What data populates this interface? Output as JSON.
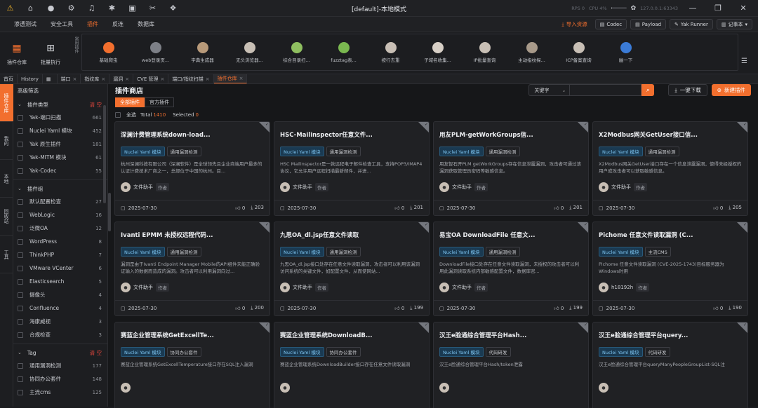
{
  "window": {
    "title": "[default]-本地模式",
    "rps_label": "RPS 0",
    "cpu_label": "CPU 4%",
    "cpu_pct": 0.04,
    "host": "127.0.0.1:63343"
  },
  "menu": {
    "items": [
      "渗透测试",
      "安全工具",
      "插件",
      "反连",
      "数据库"
    ],
    "active": "插件",
    "import": "导入资源",
    "codec": "Codec",
    "payload": "Payload",
    "yakrunner": "Yak Runner",
    "notebook": "记事本"
  },
  "toolbar": {
    "plugin_store": "插件仓库",
    "batch_exec": "批量执行",
    "fav_label": "常用插件",
    "favorites": [
      {
        "label": "基础爬虫",
        "color": "#f26f2e"
      },
      {
        "label": "web登录页...",
        "color": "#7d8087"
      },
      {
        "label": "字典生成器",
        "color": "#b89a7a"
      },
      {
        "label": "无头浏览器...",
        "color": "#c8bfb5"
      },
      {
        "label": "综合目录扫...",
        "color": "#8fbf60"
      },
      {
        "label": "fuzztag表...",
        "color": "#7ab850"
      },
      {
        "label": "按行去重",
        "color": "#c8bfb5"
      },
      {
        "label": "子域名收集...",
        "color": "#d7cfc6"
      },
      {
        "label": "IP批量查询",
        "color": "#c8bfb5"
      },
      {
        "label": "主动指纹探...",
        "color": "#a89a8a"
      },
      {
        "label": "ICP备案查询",
        "color": "#c8bfb5"
      },
      {
        "label": "幽一下",
        "color": "#3b7bd6"
      }
    ]
  },
  "tabs": [
    {
      "label": "首页"
    },
    {
      "label": "History"
    },
    {
      "label": ""
    },
    {
      "label": "端口",
      "close": "×"
    },
    {
      "label": "指纹库",
      "close": "×"
    },
    {
      "label": "漏洞",
      "close": "×"
    },
    {
      "label": "CVE 管理",
      "close": "×"
    },
    {
      "label": "端口/指纹扫描",
      "close": "×"
    },
    {
      "label": "插件仓库",
      "close": "×",
      "active": true
    }
  ],
  "rail": [
    "插件仓库",
    "我的",
    "本地",
    "回收站",
    "工具"
  ],
  "sidebar": {
    "title": "高级筛选",
    "clear": "清 空",
    "groups": [
      {
        "name": "插件类型",
        "items": [
          {
            "label": "Yak-端口扫描",
            "count": "661"
          },
          {
            "label": "Nuclei Yaml 模块",
            "count": "452"
          },
          {
            "label": "Yak 原生插件",
            "count": "181"
          },
          {
            "label": "Yak-MITM 模块",
            "count": "61"
          },
          {
            "label": "Yak-Codec",
            "count": "55"
          }
        ]
      },
      {
        "name": "插件组",
        "items": [
          {
            "label": "默认配置检查",
            "count": "27"
          },
          {
            "label": "WebLogic",
            "count": "16"
          },
          {
            "label": "泛微OA",
            "count": "12"
          },
          {
            "label": "WordPress",
            "count": "8"
          },
          {
            "label": "ThinkPHP",
            "count": "7"
          },
          {
            "label": "VMware VCenter",
            "count": "6"
          },
          {
            "label": "Elasticsearch",
            "count": "5"
          },
          {
            "label": "摄像头",
            "count": "4"
          },
          {
            "label": "Confluence",
            "count": "4"
          },
          {
            "label": "海康威视",
            "count": "3"
          },
          {
            "label": "合规检查",
            "count": "3"
          }
        ]
      },
      {
        "name": "Tag",
        "items": [
          {
            "label": "通用漏洞检测",
            "count": "177"
          },
          {
            "label": "协同办公套件",
            "count": "148"
          },
          {
            "label": "主流cms",
            "count": "125"
          }
        ]
      }
    ]
  },
  "content": {
    "title": "插件商店",
    "search_type": "关键字",
    "download_all": "一键下载",
    "new_plugin": "新建插件",
    "tabs": [
      "全部插件",
      "官方插件"
    ],
    "select_all": "全选",
    "total_label": "Total",
    "total": "1410",
    "selected_label": "Selected",
    "selected": "0",
    "cards": [
      {
        "title": "深澜计费管理系统down-load...",
        "tags": [
          "Nuclei Yaml 模块",
          "通用漏洞检测"
        ],
        "desc": "杭州深澜科技有限公司（深澜软件）是全球领先且企业商端用户最多的认证计费技术厂商之一，总部位于中国的杭州。目...",
        "author": "文件助手",
        "role": "作者",
        "date": "2025-07-30",
        "likes": "0",
        "downloads": "203"
      },
      {
        "title": "HSC-Mailinspector任意文件...",
        "tags": [
          "Nuclei Yaml 模块",
          "通用漏洞检测"
        ],
        "desc": "HSC Mailinspector是一款远程电子邮件检查工具，支持POP3/IMAP4协议，它允许用户远程扫描最新邮件，并进...",
        "author": "文件助手",
        "role": "作者",
        "date": "2025-07-30",
        "likes": "0",
        "downloads": "201"
      },
      {
        "title": "用友PLM-getWorkGroups信...",
        "tags": [
          "Nuclei Yaml 模块",
          "通用漏洞检测"
        ],
        "desc": "用友智石开PLM getWorkGroups存在信息泄露漏洞，攻击者可通过该漏洞获取管理员密码等敏感信息。",
        "author": "文件助手",
        "role": "作者",
        "date": "2025-07-30",
        "likes": "0",
        "downloads": "201"
      },
      {
        "title": "X2Modbus网关GetUser接口信...",
        "tags": [
          "Nuclei Yaml 模块",
          "通用漏洞检测"
        ],
        "desc": "X2Modbus网关GetUser接口存在一个信息泄露漏洞，使得未经授权的用户成攻击者可以获取敏感信息。",
        "author": "文件助手",
        "role": "作者",
        "date": "2025-07-30",
        "likes": "0",
        "downloads": "205"
      },
      {
        "title": "Ivanti EPMM 未授权远程代码...",
        "tags": [
          "Nuclei Yaml 模块",
          "通用漏洞检测"
        ],
        "desc": "漏洞是由于Ivanti Endpoint Manager Mobile的API组件未能正确验证输入的数据而造成的漏洞。攻击者可以利用漏洞向过...",
        "author": "文件助手",
        "role": "作者",
        "date": "2025-07-30",
        "likes": "0",
        "downloads": "200"
      },
      {
        "title": "九思OA_dl.jsp任意文件读取",
        "tags": [
          "Nuclei Yaml 模块",
          "通用漏洞检测"
        ],
        "desc": "九思OA_dl.jsp接口处存在任意文件读取漏洞，攻击者可以利用该漏洞访问系统的关键文件，如配置文件，从而使网站...",
        "author": "文件助手",
        "role": "作者",
        "date": "2025-07-30",
        "likes": "0",
        "downloads": "199"
      },
      {
        "title": "易宝OA DownloadFile 任意文...",
        "tags": [
          "Nuclei Yaml 模块",
          "通用漏洞检测"
        ],
        "desc": "DownloadFile接口处存在任意文件读取漏洞，未授权的攻击者可以利用此漏洞读取系统内部敏感配置文件，数据库密...",
        "author": "文件助手",
        "role": "作者",
        "date": "2025-07-30",
        "likes": "0",
        "downloads": "199"
      },
      {
        "title": "Pichome 任意文件读取漏洞 (C...",
        "tags": [
          "Nuclei Yaml 模块",
          "主流CMS"
        ],
        "desc": "Pichome 任意文件读取漏洞 (CVE-2025-1743)目标服务器为Windows时用",
        "author": "h18192h",
        "role": "作者",
        "date": "2025-07-30",
        "likes": "0",
        "downloads": "190"
      },
      {
        "title": "赛蓝企业管理系统GetExcellTe...",
        "tags": [
          "Nuclei Yaml 模块",
          "协同办公套件"
        ],
        "desc": "赛蓝企业管理系统GetExcellTemperature接口存在SQL注入漏洞",
        "author": "",
        "role": "",
        "date": "",
        "likes": "",
        "downloads": ""
      },
      {
        "title": "赛蓝企业管理系统DownloadB...",
        "tags": [
          "Nuclei Yaml 模块",
          "协同办公套件"
        ],
        "desc": "赛蓝企业管理系统DownloadBuilder接口存在任意文件读取漏洞",
        "author": "",
        "role": "",
        "date": "",
        "likes": "",
        "downloads": ""
      },
      {
        "title": "汉王e脸通综合管理平台Hash...",
        "tags": [
          "Nuclei Yaml 模块",
          "代码研发"
        ],
        "desc": "汉王e脸通综合管理平台Hash/token泄露",
        "author": "",
        "role": "",
        "date": "",
        "likes": "",
        "downloads": ""
      },
      {
        "title": "汉王e脸通综合管理平台query...",
        "tags": [
          "Nuclei Yaml 模块",
          "代码研发"
        ],
        "desc": "汉王e脸通综合管理平台queryManyPeopleGroupList-SQL注",
        "author": "",
        "role": "",
        "date": "",
        "likes": "",
        "downloads": ""
      }
    ]
  }
}
